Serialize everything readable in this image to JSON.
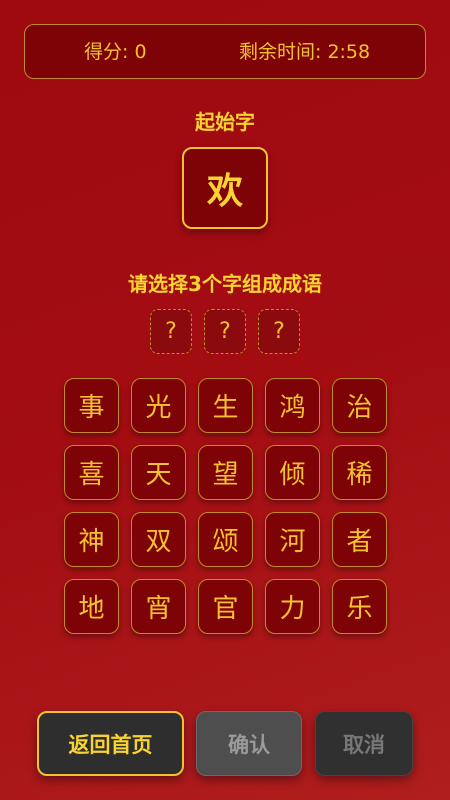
{
  "header": {
    "score_text": "得分: 0",
    "time_text": "剩余时间: 2:58"
  },
  "start": {
    "label": "起始字",
    "char": "欢"
  },
  "instruction": "请选择3个字组成成语",
  "slots": [
    "?",
    "?",
    "?"
  ],
  "tiles": [
    [
      "事",
      "光",
      "生",
      "鸿",
      "治"
    ],
    [
      "喜",
      "天",
      "望",
      "倾",
      "稀"
    ],
    [
      "神",
      "双",
      "颂",
      "河",
      "者"
    ],
    [
      "地",
      "宵",
      "官",
      "力",
      "乐"
    ]
  ],
  "buttons": {
    "home": "返回首页",
    "confirm": "确认",
    "cancel": "取消"
  },
  "colors": {
    "accent": "#f2c230",
    "tile_bg": "#7e0306",
    "background": "#a30d12"
  }
}
